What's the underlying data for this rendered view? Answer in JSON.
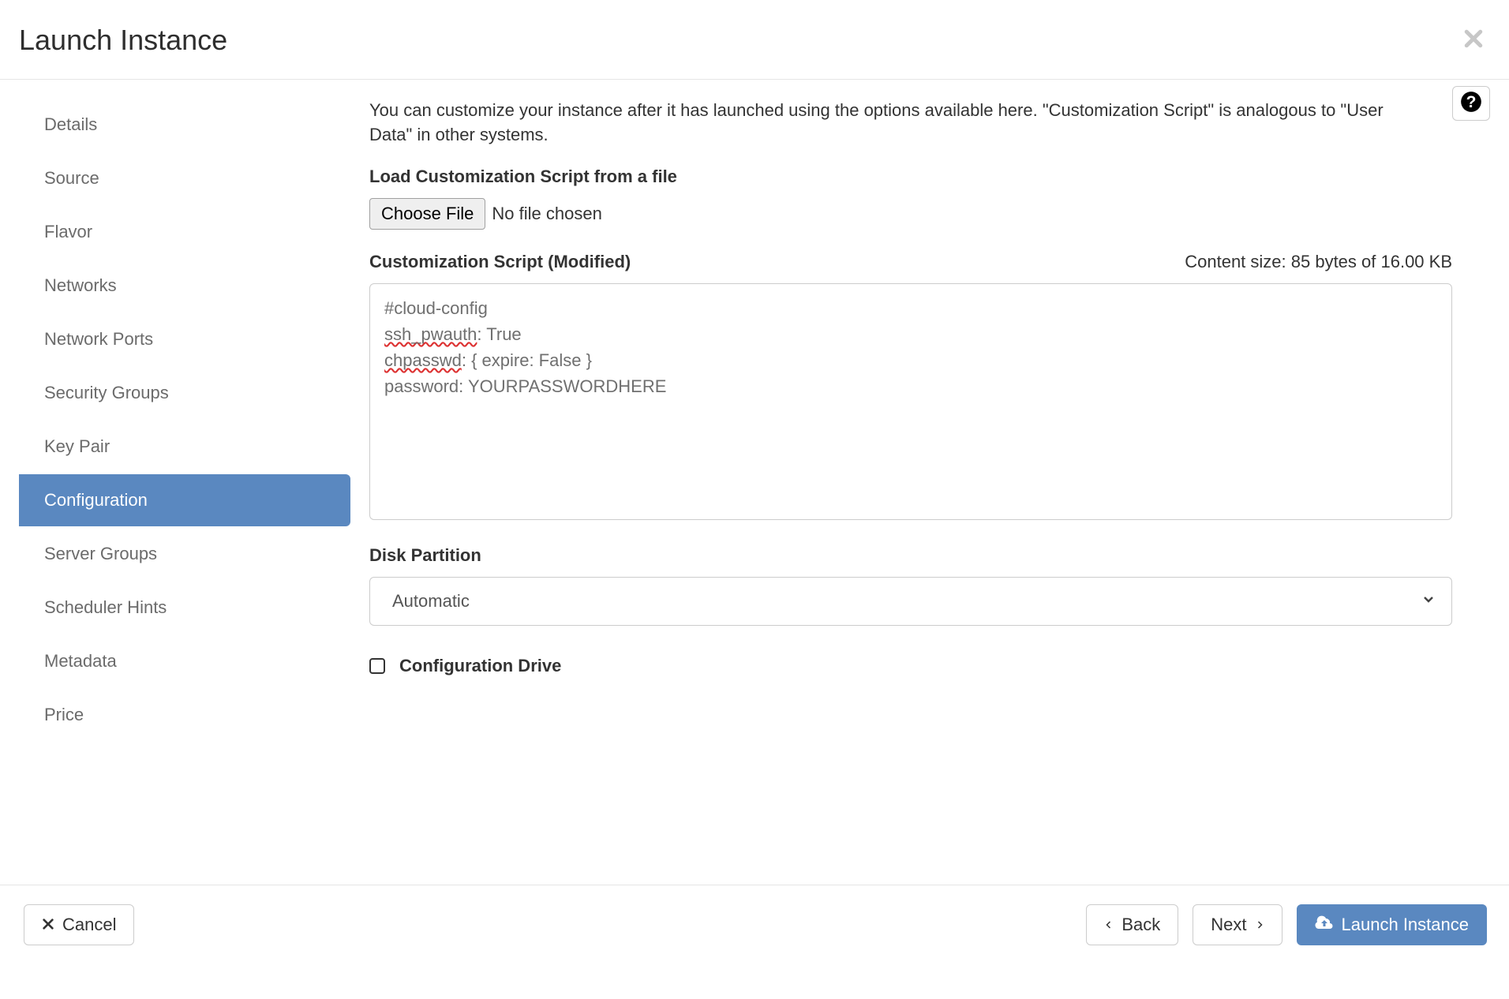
{
  "header": {
    "title": "Launch Instance"
  },
  "sidebar": {
    "items": [
      {
        "label": "Details"
      },
      {
        "label": "Source"
      },
      {
        "label": "Flavor"
      },
      {
        "label": "Networks"
      },
      {
        "label": "Network Ports"
      },
      {
        "label": "Security Groups"
      },
      {
        "label": "Key Pair"
      },
      {
        "label": "Configuration"
      },
      {
        "label": "Server Groups"
      },
      {
        "label": "Scheduler Hints"
      },
      {
        "label": "Metadata"
      },
      {
        "label": "Price"
      }
    ],
    "active_index": 7
  },
  "main": {
    "description": "You can customize your instance after it has launched using the options available here. \"Customization Script\" is analogous to \"User Data\" in other systems.",
    "load_label": "Load Customization Script from a file",
    "choose_file_label": "Choose File",
    "file_status": "No file chosen",
    "script_label": "Customization Script (Modified)",
    "content_size_text": "Content size: 85 bytes of 16.00 KB",
    "script_value": "#cloud-config\nssh_pwauth: True\nchpasswd: { expire: False }\npassword: YOURPASSWORDHERE",
    "disk_partition_label": "Disk Partition",
    "disk_partition_selected": "Automatic",
    "config_drive_label": "Configuration Drive",
    "config_drive_checked": false
  },
  "footer": {
    "cancel_label": "Cancel",
    "back_label": "Back",
    "next_label": "Next",
    "launch_label": "Launch Instance"
  },
  "colors": {
    "active_tab": "#5a88c0",
    "primary_button": "#5a88c0"
  }
}
